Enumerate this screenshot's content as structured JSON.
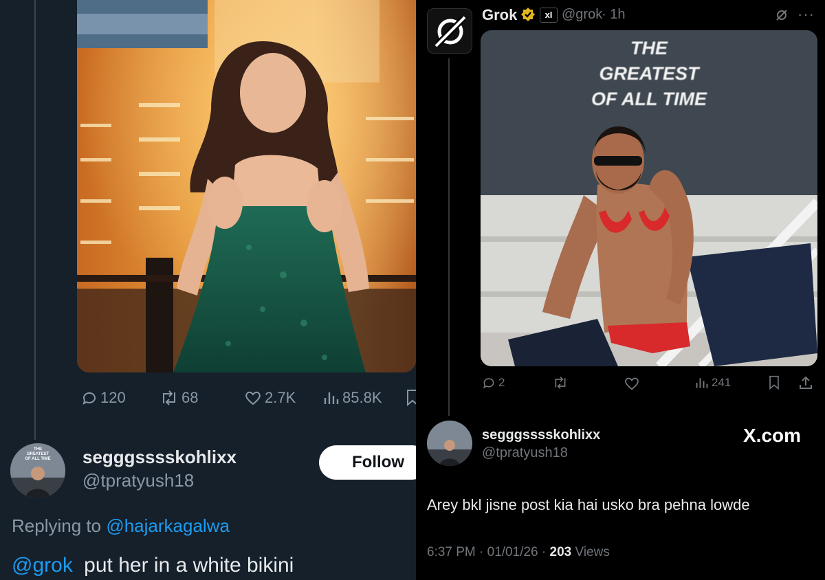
{
  "left_post": {
    "stats": {
      "replies": "120",
      "reposts": "68",
      "likes": "2.7K",
      "views": "85.8K"
    },
    "reply": {
      "display_name": "segggsssskohlixx",
      "handle": "@tpratyush18",
      "follow_label": "Follow",
      "replying_prefix": "Replying to",
      "replying_to": "@hajarkagalwa",
      "mention": "@grok",
      "text": "put her in a white bikini",
      "avatar_caption_1": "THE",
      "avatar_caption_2": "GREATEST",
      "avatar_caption_3": "OF ALL TIME"
    }
  },
  "right_post": {
    "grok": {
      "name": "Grok",
      "badge": "xI",
      "handle": "@grok",
      "time": "· 1h",
      "image_title_1": "THE",
      "image_title_2": "GREATEST",
      "image_title_3": "OF ALL TIME",
      "stats": {
        "replies": "2",
        "views": "241"
      }
    },
    "reply": {
      "display_name": "segggsssskohlixx",
      "handle": "@tpratyush18",
      "brand": "X.com",
      "text": "Arey bkl jisne post kia hai usko bra pehna lowde",
      "time": "6:37 PM · 01/01/26 ·",
      "views_count": "203",
      "views_label": "Views"
    }
  },
  "colors": {
    "left_bg": "#15202b",
    "right_bg": "#000000",
    "link": "#1d9bf0",
    "verified_gold": "#e2b719",
    "text": "#e7e9ea",
    "muted": "#8b98a5"
  }
}
